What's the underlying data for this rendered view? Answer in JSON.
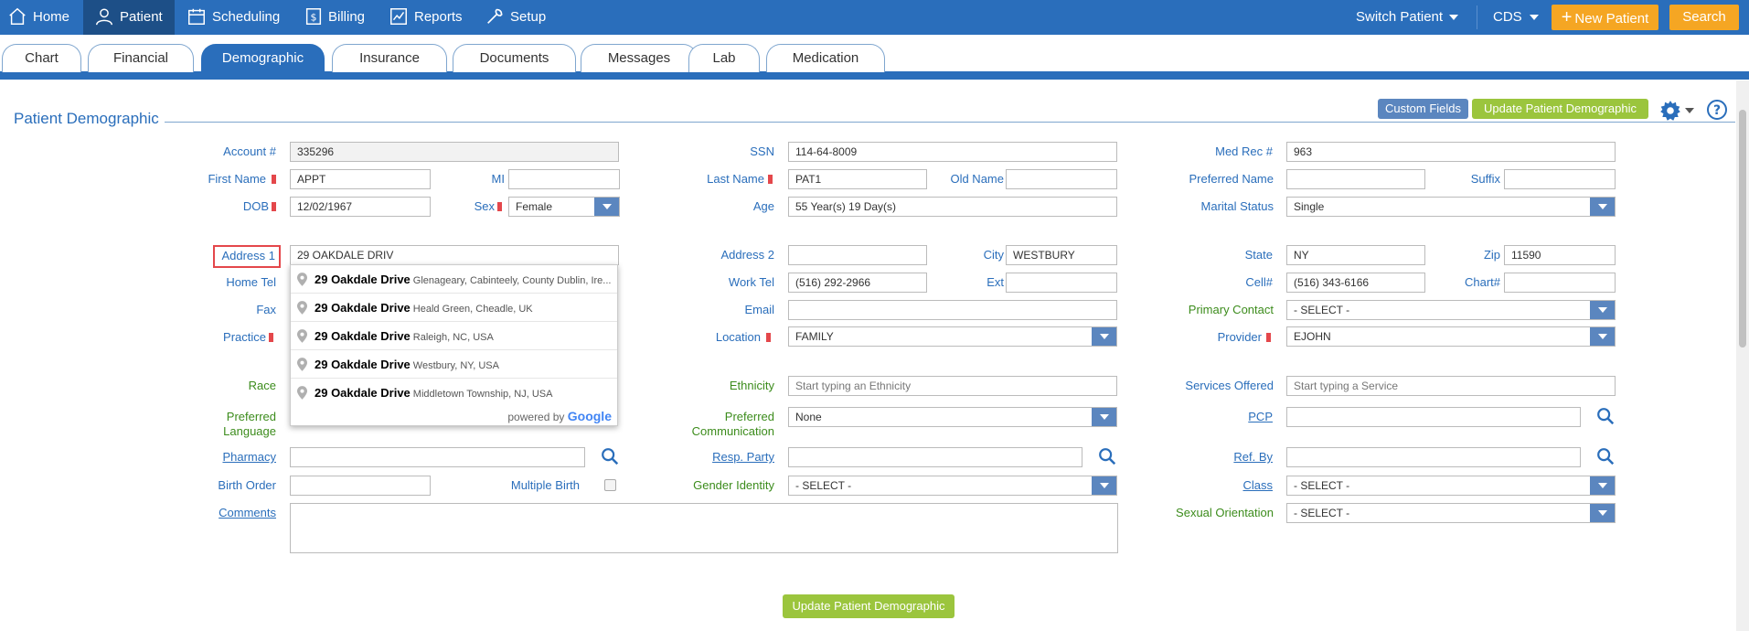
{
  "nav": {
    "home": "Home",
    "patient": "Patient",
    "scheduling": "Scheduling",
    "billing": "Billing",
    "reports": "Reports",
    "setup": "Setup",
    "switch_patient": "Switch Patient",
    "cds": "CDS",
    "new_patient": "New Patient",
    "search": "Search"
  },
  "tabs": [
    "Chart",
    "Financial",
    "Demographic",
    "Insurance",
    "Documents",
    "Messages",
    "Lab",
    "Medication"
  ],
  "section": {
    "title": "Patient Demographic",
    "custom_fields": "Custom Fields",
    "update_top": "Update Patient Demographic",
    "update_bottom": "Update Patient Demographic"
  },
  "labels": {
    "account": "Account #",
    "first_name": "First Name",
    "mi": "MI",
    "dob": "DOB",
    "sex": "Sex",
    "address1": "Address 1",
    "home_tel": "Home Tel",
    "fax": "Fax",
    "practice": "Practice",
    "race": "Race",
    "preferred_language": "Preferred Language",
    "pharmacy": "Pharmacy",
    "birth_order": "Birth Order",
    "multiple_birth": "Multiple Birth",
    "comments": "Comments",
    "ssn": "SSN",
    "last_name": "Last Name",
    "old_name": "Old Name",
    "age": "Age",
    "address2": "Address 2",
    "city": "City",
    "work_tel": "Work Tel",
    "ext": "Ext",
    "email": "Email",
    "location": "Location",
    "ethnicity": "Ethnicity",
    "preferred_communication": "Preferred Communication",
    "resp_party": "Resp. Party",
    "gender_identity": "Gender Identity",
    "med_rec": "Med Rec #",
    "preferred_name": "Preferred Name",
    "suffix": "Suffix",
    "marital_status": "Marital Status",
    "state": "State",
    "zip": "Zip",
    "cell": "Cell#",
    "chart": "Chart#",
    "primary_contact": "Primary Contact",
    "provider": "Provider",
    "services_offered": "Services Offered",
    "pcp": "PCP",
    "ref_by": "Ref. By",
    "class": "Class",
    "sexual_orientation": "Sexual Orientation"
  },
  "values": {
    "account": "335296",
    "first_name": "APPT",
    "mi": "",
    "dob": "12/02/1967",
    "sex": "Female",
    "address1": "29 OAKDALE DRIV",
    "ssn": "114-64-8009",
    "last_name": "PAT1",
    "old_name": "",
    "age": "55 Year(s) 19 Day(s)",
    "address2": "",
    "city": "WESTBURY",
    "work_tel": "(516) 292-2966",
    "ext": "",
    "email": "",
    "location": "FAMILY",
    "ethnicity_placeholder": "Start typing an Ethnicity",
    "preferred_communication": "None",
    "resp_party": "",
    "gender_identity": "- SELECT -",
    "birth_order": "",
    "pharmacy": "",
    "comments": "",
    "med_rec": "963",
    "preferred_name": "",
    "suffix": "",
    "marital_status": "Single",
    "state": "NY",
    "zip": "11590",
    "cell": "(516) 343-6166",
    "chart": "",
    "primary_contact": "- SELECT -",
    "provider": "EJOHN",
    "services_placeholder": "Start typing a Service",
    "pcp": "",
    "ref_by": "",
    "class": "- SELECT -",
    "sexual_orientation": "- SELECT -"
  },
  "autocomplete": {
    "items": [
      {
        "main": "29 Oakdale Drive",
        "bold": "Oakdale Drive",
        "secondary": "Glenageary, Cabinteely, County Dublin, Ire..."
      },
      {
        "main": "29 Oakdale Drive",
        "bold": "Oakdale Drive",
        "secondary": "Heald Green, Cheadle, UK"
      },
      {
        "main": "29 Oakdale Drive",
        "bold": "Oakdale Drive",
        "secondary": "Raleigh, NC, USA"
      },
      {
        "main": "29 Oakdale Drive",
        "bold": "Oakdale Drive",
        "secondary": "Westbury, NY, USA"
      },
      {
        "main": "29 Oakdale Drive",
        "bold": "Oakdale Drive",
        "secondary": "Middletown Township, NJ, USA"
      }
    ],
    "powered_by": "powered by",
    "brand": "Google"
  },
  "colors": {
    "nav_blue": "#2a6ebb",
    "active_nav": "#1d4f87",
    "orange": "#f5a623",
    "green": "#9bc53d",
    "required": "#e4474b"
  }
}
